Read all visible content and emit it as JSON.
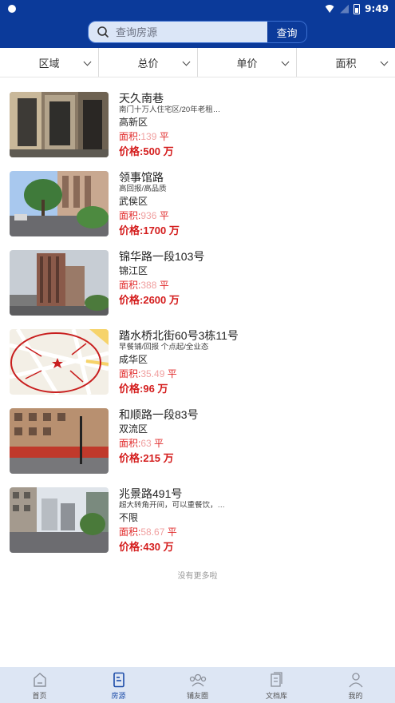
{
  "status_bar": {
    "time": "9:49"
  },
  "search": {
    "placeholder": "查询房源",
    "button_label": "查询"
  },
  "filters": [
    {
      "label": "区域"
    },
    {
      "label": "总价"
    },
    {
      "label": "单价"
    },
    {
      "label": "面积"
    }
  ],
  "listings": [
    {
      "title": "天久南巷",
      "tags": "南门十万人住宅区/20年老租…",
      "district": "高新区",
      "area_label": "面积:",
      "area_value": "139",
      "area_unit": "平",
      "price_label": "价格:",
      "price_value": "500",
      "price_unit": "万"
    },
    {
      "title": "领事馆路",
      "tags": "高回报/高品质",
      "district": "武侯区",
      "area_label": "面积:",
      "area_value": "936",
      "area_unit": "平",
      "price_label": "价格:",
      "price_value": "1700",
      "price_unit": "万"
    },
    {
      "title": "锦华路一段103号",
      "tags": "",
      "district": "锦江区",
      "area_label": "面积:",
      "area_value": "388",
      "area_unit": "平",
      "price_label": "价格:",
      "price_value": "2600",
      "price_unit": "万"
    },
    {
      "title": "踏水桥北街60号3栋11号",
      "tags": "早餐铺/回报 个点起/全业态",
      "district": "成华区",
      "area_label": "面积:",
      "area_value": "35.49",
      "area_unit": "平",
      "price_label": "价格:",
      "price_value": "96",
      "price_unit": "万"
    },
    {
      "title": "和顺路一段83号",
      "tags": "",
      "district": "双流区",
      "area_label": "面积:",
      "area_value": "63",
      "area_unit": "平",
      "price_label": "价格:",
      "price_value": "215",
      "price_unit": "万"
    },
    {
      "title": "兆景路491号",
      "tags": "超大转角开间，可以重餐饮，…",
      "district": "不限",
      "area_label": "面积:",
      "area_value": "58.67",
      "area_unit": "平",
      "price_label": "价格:",
      "price_value": "430",
      "price_unit": "万"
    }
  ],
  "footer_text": "没有更多啦",
  "nav": [
    {
      "label": "首页",
      "icon": "home-icon"
    },
    {
      "label": "房源",
      "icon": "listing-icon",
      "active": true
    },
    {
      "label": "铺友圈",
      "icon": "community-icon"
    },
    {
      "label": "文档库",
      "icon": "document-icon"
    },
    {
      "label": "我的",
      "icon": "profile-icon"
    }
  ],
  "colors": {
    "header": "#0b3a9a",
    "price": "#d41c1c",
    "nav_active": "#1c4ca8",
    "nav_bg": "#dde6f4"
  }
}
